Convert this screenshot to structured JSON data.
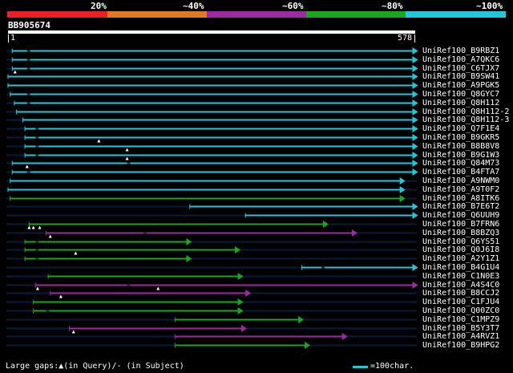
{
  "percent_labels": [
    "20%",
    "~40%",
    "~60%",
    "~80%",
    "~100%"
  ],
  "color_scale": [
    "#e8202a",
    "#e07a20",
    "#9c2aa0",
    "#1aa620",
    "#26c6da"
  ],
  "query": {
    "name": "BB905674",
    "start_label": "1",
    "end_label": "578",
    "length": 578
  },
  "hits": [
    {
      "label": "UniRef100_B9RBZ1",
      "start": 7,
      "end": 583,
      "color": "#26c6da",
      "gaps_query": [],
      "gaps_subject": [
        28
      ]
    },
    {
      "label": "UniRef100_A7QKC6",
      "start": 7,
      "end": 583,
      "color": "#26c6da",
      "gaps_query": [],
      "gaps_subject": [
        28
      ]
    },
    {
      "label": "UniRef100_C6TJX7",
      "start": 7,
      "end": 583,
      "color": "#26c6da",
      "gaps_query": [
        11
      ],
      "gaps_subject": [
        28
      ]
    },
    {
      "label": "UniRef100_B9SW41",
      "start": 1,
      "end": 583,
      "color": "#26c6da",
      "gaps_query": [],
      "gaps_subject": []
    },
    {
      "label": "UniRef100_A9PGK5",
      "start": 1,
      "end": 583,
      "color": "#26c6da",
      "gaps_query": [],
      "gaps_subject": []
    },
    {
      "label": "UniRef100_Q8GYC7",
      "start": 4,
      "end": 583,
      "color": "#26c6da",
      "gaps_query": [],
      "gaps_subject": [
        28
      ]
    },
    {
      "label": "UniRef100_Q8H112",
      "start": 10,
      "end": 583,
      "color": "#26c6da",
      "gaps_query": [],
      "gaps_subject": [
        28
      ]
    },
    {
      "label": "UniRef100_Q8H112-2",
      "start": 13,
      "end": 583,
      "color": "#26c6da",
      "gaps_query": [],
      "gaps_subject": []
    },
    {
      "label": "UniRef100_Q8H112-3",
      "start": 22,
      "end": 583,
      "color": "#26c6da",
      "gaps_query": [],
      "gaps_subject": []
    },
    {
      "label": "UniRef100_Q7F1E4",
      "start": 25,
      "end": 583,
      "color": "#26c6da",
      "gaps_query": [],
      "gaps_subject": [
        40
      ]
    },
    {
      "label": "UniRef100_B9GKR5",
      "start": 25,
      "end": 583,
      "color": "#26c6da",
      "gaps_query": [
        130
      ],
      "gaps_subject": [
        40
      ]
    },
    {
      "label": "UniRef100_B8B8V8",
      "start": 25,
      "end": 583,
      "color": "#26c6da",
      "gaps_query": [
        170
      ],
      "gaps_subject": [
        40
      ]
    },
    {
      "label": "UniRef100_B9G1W3",
      "start": 25,
      "end": 583,
      "color": "#26c6da",
      "gaps_query": [
        170
      ],
      "gaps_subject": [
        40
      ]
    },
    {
      "label": "UniRef100_Q84M73",
      "start": 7,
      "end": 583,
      "color": "#26c6da",
      "gaps_query": [
        28
      ],
      "gaps_subject": [
        170
      ]
    },
    {
      "label": "UniRef100_B4FTA7",
      "start": 7,
      "end": 583,
      "color": "#26c6da",
      "gaps_query": [],
      "gaps_subject": [
        28
      ]
    },
    {
      "label": "UniRef100_A9NWM0",
      "start": 4,
      "end": 565,
      "color": "#26c6da",
      "gaps_query": [],
      "gaps_subject": []
    },
    {
      "label": "UniRef100_A9T0F2",
      "start": 1,
      "end": 565,
      "color": "#26c6da",
      "gaps_query": [],
      "gaps_subject": []
    },
    {
      "label": "UniRef100_A8ITK6",
      "start": 4,
      "end": 565,
      "color": "#1aa620",
      "gaps_query": [],
      "gaps_subject": []
    },
    {
      "label": "UniRef100_B7E6T2",
      "start": 259,
      "end": 583,
      "color": "#26c6da",
      "gaps_query": [],
      "gaps_subject": []
    },
    {
      "label": "UniRef100_Q6UUH9",
      "start": 338,
      "end": 583,
      "color": "#26c6da",
      "gaps_query": [],
      "gaps_subject": []
    },
    {
      "label": "UniRef100_B7FRN6",
      "start": 31,
      "end": 456,
      "color": "#1aa620",
      "gaps_query": [
        31,
        37,
        46
      ],
      "gaps_subject": []
    },
    {
      "label": "UniRef100_B8BZQ3",
      "start": 55,
      "end": 497,
      "color": "#9c2aa0",
      "gaps_query": [
        61
      ],
      "gaps_subject": [
        193
      ]
    },
    {
      "label": "UniRef100_Q6YS51",
      "start": 25,
      "end": 262,
      "color": "#1aa620",
      "gaps_query": [],
      "gaps_subject": [
        40
      ]
    },
    {
      "label": "UniRef100_Q0J6I8",
      "start": 25,
      "end": 331,
      "color": "#1aa620",
      "gaps_query": [
        97
      ],
      "gaps_subject": [
        40
      ]
    },
    {
      "label": "UniRef100_A2Y1Z1",
      "start": 25,
      "end": 262,
      "color": "#1aa620",
      "gaps_query": [],
      "gaps_subject": [
        40
      ]
    },
    {
      "label": "UniRef100_B4G1U4",
      "start": 418,
      "end": 583,
      "color": "#26c6da",
      "gaps_query": [],
      "gaps_subject": [
        446
      ]
    },
    {
      "label": "UniRef100_C1N0E3",
      "start": 58,
      "end": 335,
      "color": "#1aa620",
      "gaps_query": [],
      "gaps_subject": []
    },
    {
      "label": "UniRef100_A4S4C0",
      "start": 40,
      "end": 583,
      "color": "#9c2aa0",
      "gaps_query": [
        43,
        214
      ],
      "gaps_subject": [
        170
      ]
    },
    {
      "label": "UniRef100_B8CCJ2",
      "start": 61,
      "end": 346,
      "color": "#9c2aa0",
      "gaps_query": [
        76
      ],
      "gaps_subject": []
    },
    {
      "label": "UniRef100_C1FJU4",
      "start": 37,
      "end": 335,
      "color": "#1aa620",
      "gaps_query": [],
      "gaps_subject": []
    },
    {
      "label": "UniRef100_Q00ZC0",
      "start": 37,
      "end": 335,
      "color": "#1aa620",
      "gaps_query": [],
      "gaps_subject": [
        55
      ]
    },
    {
      "label": "UniRef100_C1MPZ9",
      "start": 238,
      "end": 421,
      "color": "#1aa620",
      "gaps_query": [],
      "gaps_subject": []
    },
    {
      "label": "UniRef100_B5Y3T7",
      "start": 88,
      "end": 340,
      "color": "#9c2aa0",
      "gaps_query": [
        94
      ],
      "gaps_subject": []
    },
    {
      "label": "UniRef100_A4RVZ1",
      "start": 238,
      "end": 483,
      "color": "#9c2aa0",
      "gaps_query": [],
      "gaps_subject": []
    },
    {
      "label": "UniRef100_B9HPG2",
      "start": 238,
      "end": 430,
      "color": "#1aa620",
      "gaps_query": [],
      "gaps_subject": []
    }
  ],
  "footer": {
    "legend_text": "Large gaps:▲(in Query)/- (in Subject)",
    "scale_text": "=100char."
  }
}
